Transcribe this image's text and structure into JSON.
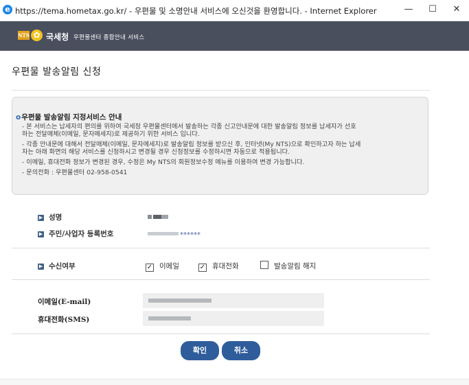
{
  "window": {
    "title": "https://tema.hometax.go.kr/ - 우편물 및 소명안내 서비스에 오신것을 환영합니다. - Internet Explorer",
    "minimize": "—",
    "maximize": "☐",
    "close": "✕"
  },
  "header": {
    "badge": "NTS",
    "agency": "국세청",
    "service": "우편물센터 종합안내 서비스"
  },
  "page": {
    "title": "우편물 발송알림 신청"
  },
  "info": {
    "heading": "우편물 발송알림 지정서비스 안내",
    "lines": [
      "- 본 서비스는 납세자의 편의를 위하여 국세청 우편물센터에서 발송하는 각종 신고안내문에 대한 발송알림 정보를 납세자가 선호",
      "  하는 전달매체(이메일, 문자메세지)로 제공하기 위한 서비스 입니다.",
      "- 각종 안내문에 대해서 전달매체(이메일, 문자메세지)로 발송알림 정보를 받으신 후, 인터넷(My NTS)으로 확인하고자 하는 납세",
      "  자는 아래 화면의 해당 서비스를 신청하시고 변경될 경우 신청정보를 수정하시면 자동으로 적용됩니다.",
      "- 이메일, 휴대전화 정보가 변경된 경우, 수정은 My NTS의 회원정보수정 메뉴를 이용하여 변경 가능합니다.",
      "- 문의전화 : 우편물센터 02-958-0541"
    ]
  },
  "form": {
    "name_label": "성명",
    "id_label": "주민/사업자 등록번호",
    "id_mask": "******",
    "receive_label": "수신여부",
    "options": [
      {
        "label": "이메일",
        "checked": true
      },
      {
        "label": "휴대전화",
        "checked": true
      },
      {
        "label": "발송알림 해지",
        "checked": false
      }
    ],
    "email_label": "이메일(E-mail)",
    "sms_label": "휴대전화(SMS)"
  },
  "buttons": {
    "ok": "확인",
    "cancel": "취소"
  },
  "icons": {
    "check": "✓",
    "bullet": "▶"
  }
}
